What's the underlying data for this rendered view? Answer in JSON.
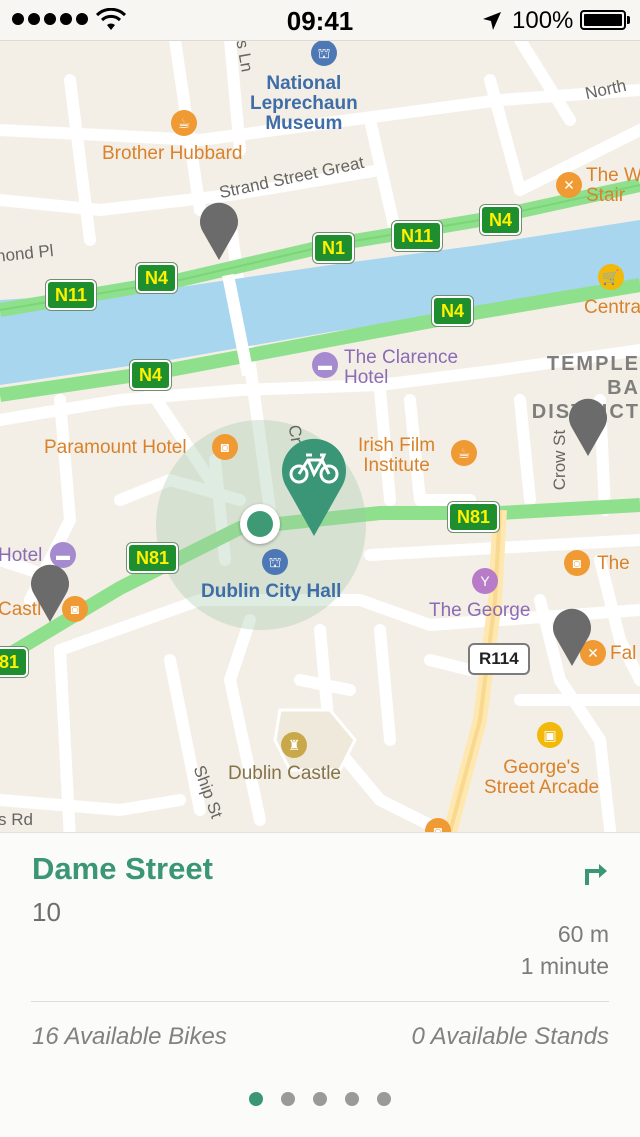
{
  "status_bar": {
    "time": "09:41",
    "battery_percent": "100%"
  },
  "map": {
    "labels": {
      "museum": "National\nLeprechaun\nMuseum",
      "brother_hubbard": "Brother Hubbard",
      "strand_street": "Strand Street Great",
      "north": "North",
      "the_w_stair": "The W\nStair",
      "centra": "Centra",
      "hond_pl": "hond Pl",
      "clarence": "The Clarence\nHotel",
      "temple_bar": "TEMPLE BA\nDISTRICT",
      "paramount": "Paramount Hotel",
      "irish_film": "Irish Film\nInstitute",
      "crow_st": "Crow St",
      "the_right": "The",
      "hotel_left": "Hotel",
      "castle_left": "Castl",
      "city_hall": "Dublin City Hall",
      "the_george": "The George",
      "fal": "Fal",
      "dublin_castle": "Dublin Castle",
      "georges_arcade": "George's\nStreet Arcade",
      "ship_st": "Ship St",
      "s_rd": "s Rd",
      "cr": "Cr",
      "s_ln": "s Ln"
    },
    "road_shields": {
      "n4_a": "N4",
      "n11_a": "N11",
      "n1": "N1",
      "n11_b": "N11",
      "n4_b": "N4",
      "n4_c": "N4",
      "n4_d": "N4",
      "n81_a": "N81",
      "n81_b": "N81",
      "n81_c": "81",
      "r114": "R114"
    }
  },
  "station": {
    "name": "Dame Street",
    "number": "10",
    "distance": "60 m",
    "duration": "1 minute",
    "available_bikes": "16 Available Bikes",
    "available_stands": "0 Available Stands"
  },
  "pager": {
    "count": 5,
    "active_index": 0
  },
  "colors": {
    "accent": "#3a9676",
    "water": "#a8d6ef",
    "motorway": "#8fe08c",
    "map_background": "#f3efe6"
  }
}
